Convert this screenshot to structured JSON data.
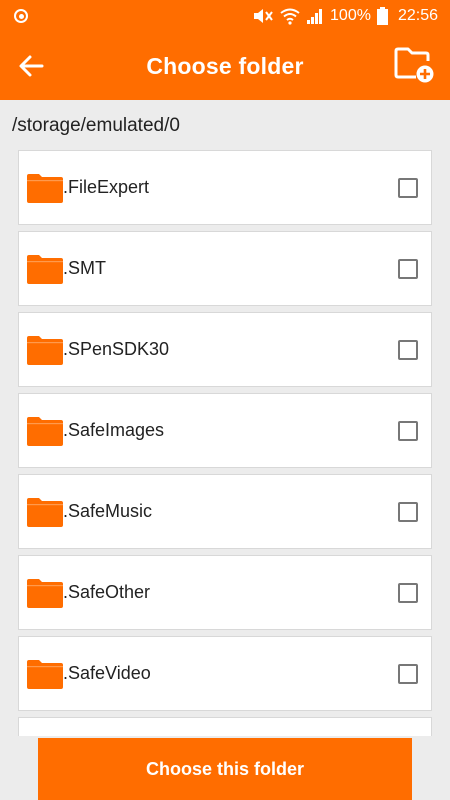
{
  "status_bar": {
    "battery": "100%",
    "time": "22:56",
    "icons": [
      "notification-dot-icon",
      "mute-icon",
      "wifi-icon",
      "signal-icon",
      "battery-icon"
    ]
  },
  "app_bar": {
    "title": "Choose folder",
    "back_icon": "back-arrow-icon",
    "new_folder_icon": "create-new-folder-icon"
  },
  "path": "/storage/emulated/0",
  "folders": [
    {
      "name": ".FileExpert",
      "checked": false
    },
    {
      "name": ".SMT",
      "checked": false
    },
    {
      "name": ".SPenSDK30",
      "checked": false
    },
    {
      "name": ".SafeImages",
      "checked": false
    },
    {
      "name": ".SafeMusic",
      "checked": false
    },
    {
      "name": ".SafeOther",
      "checked": false
    },
    {
      "name": ".SafeVideo",
      "checked": false
    },
    {
      "name": "",
      "checked": false
    }
  ],
  "action_button": "Choose this folder",
  "colors": {
    "accent": "#ff6d00",
    "background": "#ececec",
    "card": "#ffffff"
  }
}
